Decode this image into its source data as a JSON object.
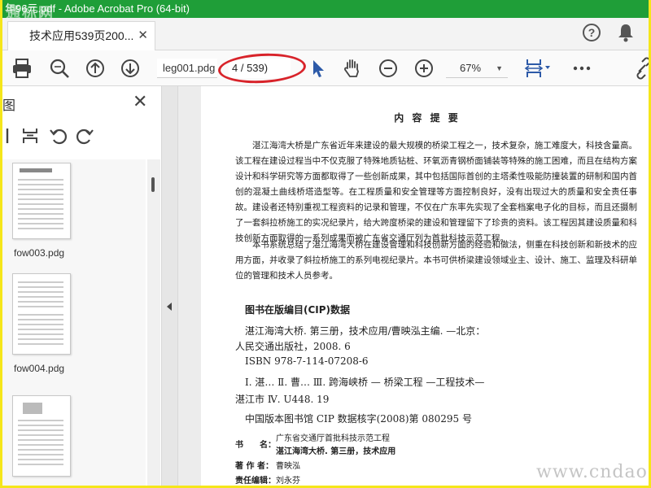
{
  "window": {
    "title": "年96元.pdf - Adobe Acrobat Pro (64-bit)",
    "watermark_top": "通标网"
  },
  "tabs": [
    {
      "label": "技术应用539页200..."
    }
  ],
  "header": {
    "help_glyph": "?"
  },
  "toolbar": {
    "file_name": "leg001.pdg",
    "page_indicator": "4 / 539)",
    "zoom": "67%",
    "icons": [
      "print-icon",
      "zoom-search-icon",
      "page-up-icon",
      "page-down-icon",
      "select-cursor-icon",
      "hand-icon",
      "zoom-out-icon",
      "zoom-in-icon",
      "fit-page-icon",
      "more-icon",
      "link-icon"
    ],
    "annotation_color": "#d8232a"
  },
  "sidebar": {
    "title_fragment": "图",
    "thumbnails": [
      {
        "label": "fow003.pdg"
      },
      {
        "label": "fow004.pdg"
      },
      {
        "label": ""
      }
    ]
  },
  "document": {
    "heading": "内 容 提 要",
    "paragraph1": "湛江海湾大桥是广东省近年来建设的最大规模的桥梁工程之一，技术复杂，施工难度大，科技含量高。该工程在建设过程当中不仅克服了特殊地质钻桩、环氧沥青钢桥面铺装等特殊的施工困难，而且在结构方案设计和科学研究等方面都取得了一些创新成果，其中包括国际首创的主塔柔性吸能防撞装置的研制和国内首创的混凝土曲线桥塔造型等。在工程质量和安全管理等方面控制良好，没有出现过大的质量和安全责任事故。建设者还特别重视工程资料的记录和管理，不仅在广东率先实现了全套档案电子化的目标，而且还摄制了一套斜拉桥施工的实况纪录片，给大跨度桥梁的建设和管理留下了珍贵的资料。该工程因其建设质量和科技创新方面取得的一系列成果而被广东省交通厅列为首批科技示范工程。",
    "paragraph2": "本书系统总结了湛江海湾大桥在建设管理和科技创新方面的经验和做法，侧重在科技创新和新技术的应用方面，并收录了斜拉桥施工的系列电视纪录片。本书可供桥梁建设领域业主、设计、施工、监理及科研单位的管理和技术人员参考。",
    "cip_heading": "图书在版编目(CIP)数据",
    "cip_line1": "湛江海湾大桥. 第三册，技术应用/曹映泓主编. —北京：",
    "cip_line2": "人民交通出版社，2008. 6",
    "cip_line3": "ISBN  978-7-114-07208-6",
    "cip_line4": "Ⅰ. 湛…  Ⅱ. 曹…  Ⅲ. 跨海峡桥 — 桥梁工程 —工程技术—",
    "cip_line5": "湛江市   Ⅳ. U448. 19",
    "cip_line6": "中国版本图书馆 CIP 数据核字(2008)第 080295 号",
    "book_label": "书　　名：",
    "book_value1": "广东省交通厅首批科技示范工程",
    "book_value2": "湛江海湾大桥. 第三册，技术应用",
    "author_label": "著 作 者：",
    "author_value": "曹映泓",
    "editor_label": "责任编辑：",
    "editor_value": "刘永芬"
  },
  "watermark_bottom": "www.cndao.com",
  "colors": {
    "titlebar": "#1f9e38",
    "frame": "#f5e61a",
    "accent": "#2d5aa8"
  }
}
